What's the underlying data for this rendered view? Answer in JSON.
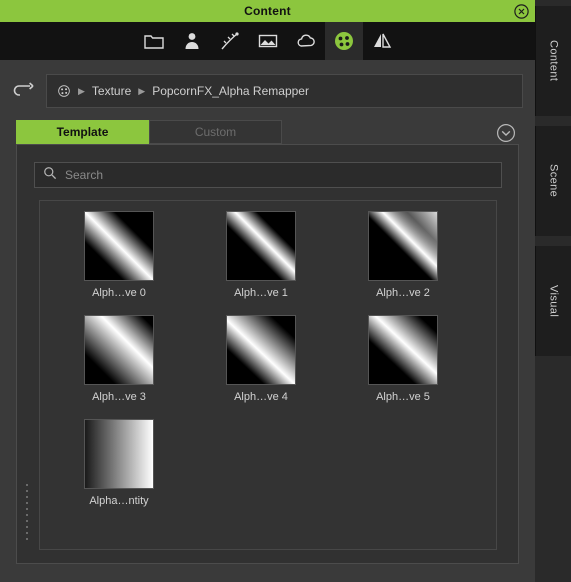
{
  "window": {
    "title": "Content",
    "close_icon": "close-circle-icon"
  },
  "toolbar": {
    "items": [
      {
        "name": "folder-icon",
        "label": "Folder"
      },
      {
        "name": "character-icon",
        "label": "Character"
      },
      {
        "name": "effect-icon",
        "label": "Effect"
      },
      {
        "name": "image-icon",
        "label": "Image"
      },
      {
        "name": "cloud-icon",
        "label": "Cloud"
      },
      {
        "name": "texture-icon",
        "label": "Texture"
      },
      {
        "name": "compare-icon",
        "label": "Compare"
      }
    ],
    "active_index": 5
  },
  "breadcrumb": {
    "back_icon": "back-arrow-icon",
    "root_icon": "texture-root-icon",
    "items": [
      "Texture",
      "PopcornFX_Alpha Remapper"
    ],
    "separator": "▶"
  },
  "tabs": {
    "items": [
      {
        "label": "Template",
        "active": true
      },
      {
        "label": "Custom",
        "active": false
      }
    ],
    "chevron_icon": "chevron-down-circle-icon"
  },
  "search": {
    "icon": "search-icon",
    "value": "",
    "placeholder": "Search"
  },
  "grid": {
    "items": [
      {
        "label": "Alph…ve 0",
        "thumb": "alpha-curve-0"
      },
      {
        "label": "Alph…ve 1",
        "thumb": "alpha-curve-1"
      },
      {
        "label": "Alph…ve 2",
        "thumb": "alpha-curve-2"
      },
      {
        "label": "Alph…ve 3",
        "thumb": "alpha-curve-3"
      },
      {
        "label": "Alph…ve 4",
        "thumb": "alpha-curve-4"
      },
      {
        "label": "Alph…ve 5",
        "thumb": "alpha-curve-5"
      },
      {
        "label": "Alpha…ntity",
        "thumb": "alpha-identity"
      }
    ]
  },
  "right_tabs": {
    "items": [
      {
        "label": "Content"
      },
      {
        "label": "Scene"
      },
      {
        "label": "Visual"
      }
    ]
  },
  "colors": {
    "accent": "#8cc63e",
    "panel": "#3a3a3a",
    "toolbar": "#121212",
    "well": "#313131"
  }
}
